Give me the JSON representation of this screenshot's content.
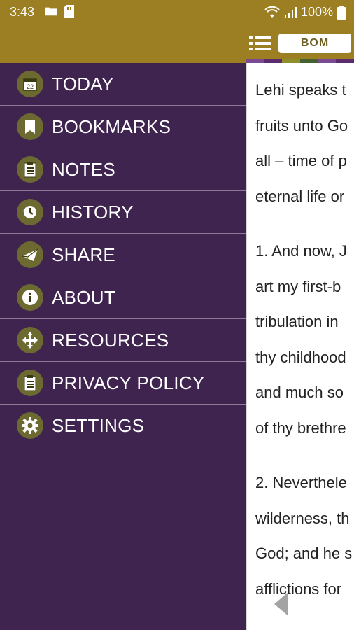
{
  "status_bar": {
    "time": "3:43",
    "battery": "100%"
  },
  "app_bar": {
    "badge_label": "BOM"
  },
  "drawer": {
    "items": [
      {
        "label": "TODAY",
        "icon": "calendar-icon"
      },
      {
        "label": "BOOKMARKS",
        "icon": "bookmark-icon"
      },
      {
        "label": "NOTES",
        "icon": "notes-icon"
      },
      {
        "label": "HISTORY",
        "icon": "history-icon"
      },
      {
        "label": "SHARE",
        "icon": "share-icon"
      },
      {
        "label": "ABOUT",
        "icon": "info-icon"
      },
      {
        "label": "RESOURCES",
        "icon": "resources-icon"
      },
      {
        "label": "PRIVACY POLICY",
        "icon": "privacy-icon"
      },
      {
        "label": "SETTINGS",
        "icon": "gear-icon"
      }
    ],
    "today_day": "22"
  },
  "content": {
    "paragraphs": [
      {
        "lines": [
          "Lehi speaks t",
          "fruits unto Go",
          "all – time of p",
          "eternal life or"
        ]
      },
      {
        "lines": [
          "1. And now, J",
          "art my first-b",
          "tribulation in",
          "thy childhood",
          "and much so",
          "of thy brethre"
        ]
      },
      {
        "lines": [
          "2. Neverthele",
          "wilderness, th",
          "God; and he s",
          "afflictions for"
        ]
      }
    ]
  },
  "colors": {
    "appbar": "#9b7f22",
    "drawer": "#402450",
    "icon_circle": "#6d6a31",
    "stripe": [
      "#7b4a93",
      "#5b2b6e",
      "#8e8e2a",
      "#44622f",
      "#7b4a93",
      "#5b2b6e"
    ]
  }
}
